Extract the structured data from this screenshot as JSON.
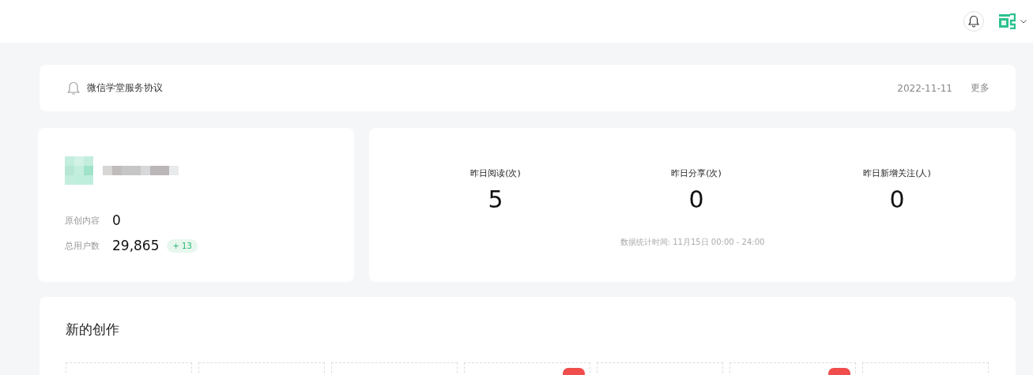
{
  "notice": {
    "text": "微信学堂服务协议",
    "date": "2022-11-11",
    "more": "更多"
  },
  "account": {
    "stats": [
      {
        "label": "原创内容",
        "value": "0"
      },
      {
        "label": "总用户数",
        "value": "29,865",
        "delta": "+ 13"
      }
    ]
  },
  "yesterday": {
    "metrics": [
      {
        "label": "昨日阅读(次)",
        "value": "5"
      },
      {
        "label": "昨日分享(次)",
        "value": "0"
      },
      {
        "label": "昨日新增关注(人)",
        "value": "0"
      }
    ],
    "note": "数据统计时间: 11月15日 00:00 - 24:00"
  },
  "creations": {
    "title": "新的创作",
    "cards": [
      {
        "badge": false
      },
      {
        "badge": false
      },
      {
        "badge": false
      },
      {
        "badge": true
      },
      {
        "badge": false
      },
      {
        "badge": true
      },
      {
        "badge": false
      }
    ]
  }
}
